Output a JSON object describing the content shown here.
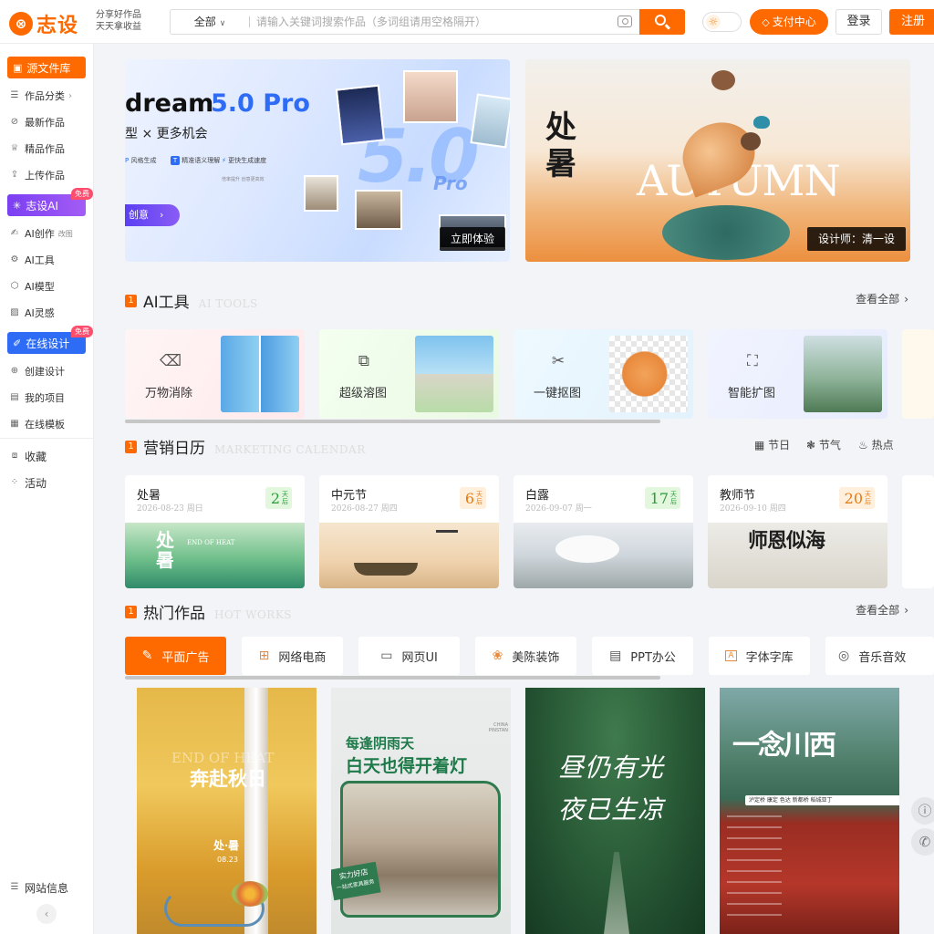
{
  "header": {
    "logo_mark": "⊗",
    "logo_text": "志设",
    "slogan_line1": "分享好作品",
    "slogan_line2": "天天拿收益",
    "search_category": "全部",
    "search_placeholder": "请输入关键词搜索作品（多词组请用空格隔开）",
    "pay_center": "支付中心",
    "login": "登录",
    "register": "注册"
  },
  "sidebar": {
    "source_library": "源文件库",
    "items_a": [
      "作品分类",
      "最新作品",
      "精品作品",
      "上传作品"
    ],
    "ai_section": "志设AI",
    "ai_badge": "免费",
    "items_b": [
      "AI创作",
      "AI工具",
      "AI模型",
      "AI灵感"
    ],
    "ai_create_sub": "改图",
    "design_section": "在线设计",
    "design_badge": "免费",
    "items_c": [
      "创建设计",
      "我的项目",
      "在线模板"
    ],
    "items_d": [
      "收藏",
      "活动"
    ],
    "site_info": "网站信息"
  },
  "banners": {
    "left_title": "dream",
    "left_version": "5.0 Pro",
    "left_subtitle": "型 × 更多机会",
    "left_feature1": "风格生成",
    "left_feature2": "精准语义理解",
    "left_feature3": "更快生成速度",
    "left_feature3_sub": "倍率提升 创意更高效",
    "left_big": "5.0",
    "left_big_pro": "Pro",
    "left_cta": "创意",
    "left_tag": "立即体验",
    "right_calligraphy": "处暑",
    "right_word": "AUTUMN",
    "right_tag": "设计师：清一设"
  },
  "ai_tools": {
    "title": "AI工具",
    "title_en": "AI TOOLS",
    "view_all": "查看全部",
    "cards": [
      {
        "name": "万物消除",
        "icon": "⌫"
      },
      {
        "name": "超级溶图",
        "icon": "⧉"
      },
      {
        "name": "一键抠图",
        "icon": "✂"
      },
      {
        "name": "智能扩图",
        "icon": "⛶"
      }
    ]
  },
  "calendar": {
    "title": "营销日历",
    "title_en": "MARKETING CALENDAR",
    "filters": [
      "节日",
      "节气",
      "热点"
    ],
    "unit_top": "天",
    "unit_bottom": "后",
    "cards": [
      {
        "name": "处暑",
        "date": "2026-08-23 周日",
        "days": "2",
        "img_text": "处暑",
        "img_text_en": "END OF HEAT"
      },
      {
        "name": "中元节",
        "date": "2026-08-27 周四",
        "days": "6"
      },
      {
        "name": "白露",
        "date": "2026-09-07 周一",
        "days": "17"
      },
      {
        "name": "教师节",
        "date": "2026-09-10 周四",
        "days": "20",
        "img_text": "师恩似海"
      }
    ]
  },
  "hot_works": {
    "title": "热门作品",
    "title_en": "HOT WORKS",
    "view_all": "查看全部",
    "tabs": [
      {
        "label": "平面广告",
        "icon": "✎"
      },
      {
        "label": "网络电商",
        "icon": "⊞"
      },
      {
        "label": "网页UI",
        "icon": "▭"
      },
      {
        "label": "美陈装饰",
        "icon": "❀"
      },
      {
        "label": "PPT办公",
        "icon": "▤"
      },
      {
        "label": "字体字库",
        "icon": "A"
      },
      {
        "label": "音乐音效",
        "icon": "◎"
      }
    ],
    "works": [
      {
        "headline": "奔赴秋日",
        "en": "END OF HEAT",
        "sub": "处·暑",
        "date": "08.23"
      },
      {
        "headline": "每逢阴雨天",
        "headline2": "白天也得开着灯",
        "corner": "CHINA PINSTAN",
        "stamp": "实力好店",
        "stamp2": "一站式家具服务"
      },
      {
        "headline": "昼仍有光",
        "headline2": "夜已生凉"
      },
      {
        "headline": "一念川西",
        "sub": "泸定桥 康定 色达 新都桥 稻城亚丁"
      }
    ]
  },
  "colors": {
    "accent": "#ff6a00",
    "ai_purple": "#7b3ff2",
    "design_blue": "#2f6cf6"
  }
}
